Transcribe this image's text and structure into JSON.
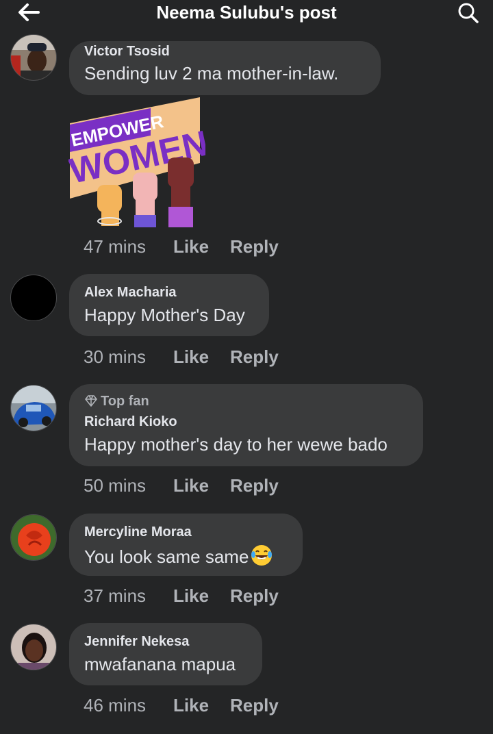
{
  "header": {
    "title": "Neema Sulubu's post",
    "back_icon": "arrow-left-icon",
    "search_icon": "search-icon"
  },
  "sticker": {
    "line1": "EMPOWER",
    "line2": "WOMEN",
    "colors": {
      "banner": "#f3c28a",
      "purple": "#7a2fc4",
      "label": "#ffffff"
    }
  },
  "comments": [
    {
      "author": "Victor Tsosid",
      "text": "Sending luv  2  ma mother-in-law.",
      "time": "47 mins",
      "like": "Like",
      "reply": "Reply"
    },
    {
      "author": "Alex Macharia",
      "text": "Happy Mother's Day",
      "time": "30 mins",
      "like": "Like",
      "reply": "Reply"
    },
    {
      "badge": "Top fan",
      "author": "Richard Kioko",
      "text": "Happy mother's day to her wewe bado",
      "time": "50 mins",
      "like": "Like",
      "reply": "Reply"
    },
    {
      "author": "Mercyline Moraa",
      "text": "You look same same",
      "emoji": "laughing-tears-emoji",
      "time": "37 mins",
      "like": "Like",
      "reply": "Reply"
    },
    {
      "author": "Jennifer Nekesa",
      "text": "mwafanana mapua",
      "time": "46 mins",
      "like": "Like",
      "reply": "Reply"
    }
  ],
  "colors": {
    "background": "#242526",
    "bubble": "#3a3b3c",
    "primary_text": "#e4e6eb",
    "secondary_text": "#b0b3b8"
  }
}
